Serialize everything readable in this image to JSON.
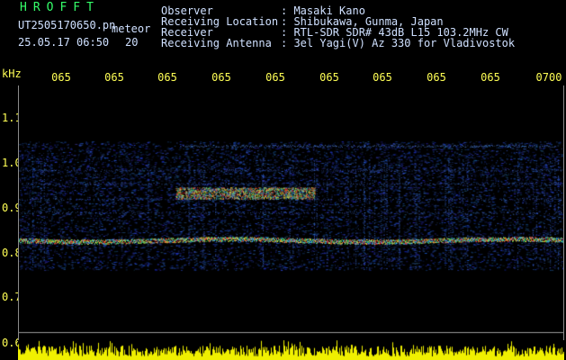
{
  "brand": "HROFFT",
  "file_name": "UT2505170650.pn",
  "product_label": "meteor",
  "date_time": "25.05.17 06:50",
  "interval": "20",
  "info": {
    "observer_label": "Observer",
    "observer_value": ": Masaki Kano",
    "location_label": "Receiving Location",
    "location_value": ": Shibukawa, Gunma, Japan",
    "receiver_label": "Receiver",
    "receiver_value": ": RTL-SDR SDR# 43dB L15 103.2MHz CW",
    "antenna_label": "Receiving Antenna",
    "antenna_value": ": 3el Yagi(V) Az 330 for Vladivostok"
  },
  "y_axis": {
    "unit": "kHz",
    "ticks": [
      "1.1",
      "1.0",
      "0.9",
      "0.8",
      "0.7",
      "0.6"
    ]
  },
  "x_axis": {
    "ticks": [
      "065",
      "065",
      "065",
      "065",
      "065",
      "065",
      "065",
      "065",
      "065",
      "0700"
    ]
  },
  "colors": {
    "background": "#000000",
    "text_yellow": "#ffff55",
    "brand_green": "#35ff6a",
    "signal_blue": "#1f3fa8",
    "signal_red": "#ff3030"
  }
}
